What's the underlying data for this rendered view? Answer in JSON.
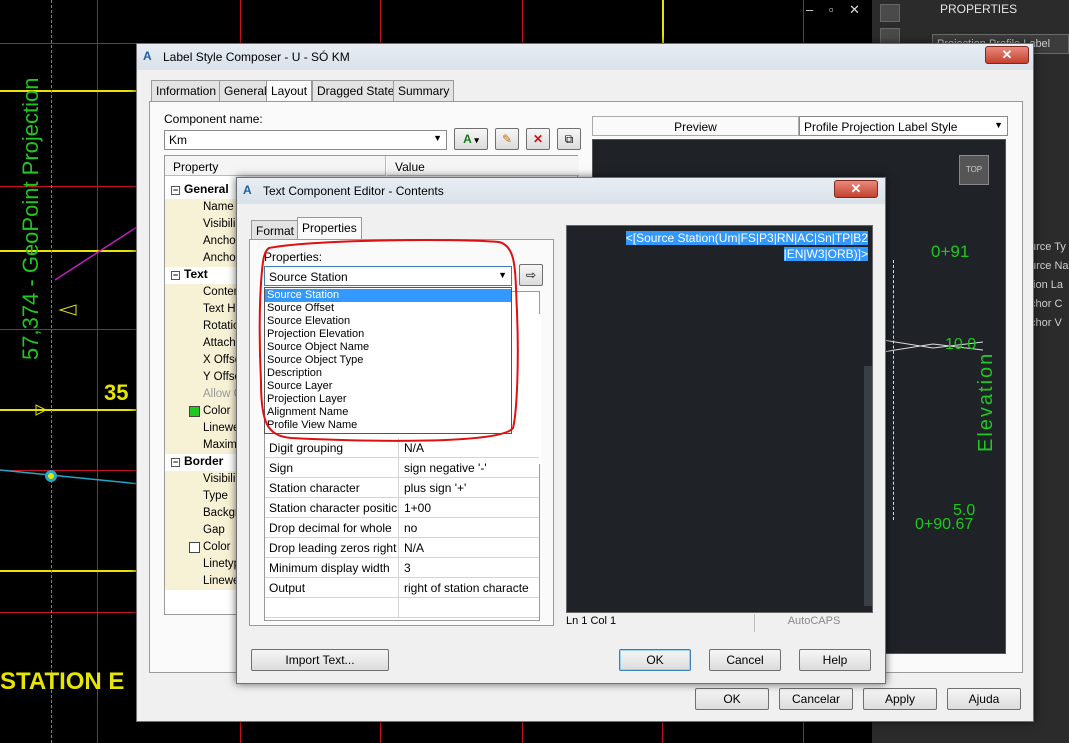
{
  "cad": {
    "vertical_text": "57,374 - GeoPoint Projection",
    "number_35": "35",
    "station_text": "STATION E",
    "preview_labels": {
      "top_station": "0+91",
      "elev_upper": "10.0",
      "elev_lower": "5.0",
      "bottom_station": "0+90.67",
      "elevation_axis": "Elevation"
    },
    "top_button": "TOP"
  },
  "window_controls": "– ▫ ✕",
  "properties_palette": {
    "title": "PROPERTIES",
    "combo_value": "Projection Profile Label",
    "rows": [
      "urce Ty",
      "urce Na",
      "tion La",
      "chor C",
      "chor V"
    ]
  },
  "label_style_composer": {
    "title": "Label Style Composer - U - SÓ KM",
    "close": "✕",
    "tabs": [
      "Information",
      "General",
      "Layout",
      "Dragged State",
      "Summary"
    ],
    "active_tab": "Layout",
    "component_name_label": "Component name:",
    "component_name_value": "Km",
    "grid_headers": {
      "property": "Property",
      "value": "Value"
    },
    "categories": {
      "general": {
        "label": "General",
        "items": [
          "Name",
          "Visibili",
          "Ancho",
          "Ancho"
        ]
      },
      "text": {
        "label": "Text",
        "items": [
          "Conten",
          "Text H",
          "Rotatio",
          "Attach",
          "X Offse",
          "Y Offse",
          "Allow C",
          "Color",
          "Linewe",
          "Maximu"
        ]
      },
      "border": {
        "label": "Border",
        "items": [
          "Visibili",
          "Type",
          "Backgr",
          "Gap",
          "Color",
          "Linetyp",
          "Linewe"
        ]
      }
    },
    "preview_label": "Preview",
    "preview_style": "Profile Projection Label Style",
    "buttons": {
      "ok": "OK",
      "cancel": "Cancelar",
      "apply": "Apply",
      "help": "Ajuda"
    }
  },
  "text_component_editor": {
    "title": "Text Component Editor - Contents",
    "close": "✕",
    "tabs": [
      "Format",
      "Properties"
    ],
    "active_tab": "Properties",
    "properties_label": "Properties:",
    "properties_value": "Source Station",
    "dropdown_options": [
      "Source Station",
      "Source Offset",
      "Source Elevation",
      "Projection Elevation",
      "Source Object Name",
      "Source Object Type",
      "Description",
      "Source Layer",
      "Projection Layer",
      "Alignment Name",
      "Profile View Name"
    ],
    "selected_option": "Source Station",
    "grid_rows": [
      {
        "k": "Digit grouping",
        "v": "N/A"
      },
      {
        "k": "Sign",
        "v": "sign negative '-'"
      },
      {
        "k": "Station character",
        "v": "plus sign '+'"
      },
      {
        "k": "Station character positic",
        "v": "1+00"
      },
      {
        "k": "Drop decimal for whole",
        "v": "no"
      },
      {
        "k": "Drop leading zeros right",
        "v": "N/A"
      },
      {
        "k": "Minimum display width",
        "v": "3"
      },
      {
        "k": "Output",
        "v": "right of station characte"
      }
    ],
    "editor_text_line1": "<[Source Station(Um|FS|P3|RN|AC|Sn|TP|B2",
    "editor_text_line2": "|EN|W3|ORB)]>",
    "status_pos": "Ln 1 Col 1",
    "status_caps": "AutoCAPS",
    "buttons": {
      "import": "Import Text...",
      "ok": "OK",
      "cancel": "Cancel",
      "help": "Help"
    }
  },
  "colors": {
    "cad_bg": "#000000",
    "grid_red": "#c8141e",
    "cad_green": "#1ec81e",
    "cad_yellow": "#e6e600",
    "annotation_red": "#e01010",
    "selection_blue": "#3399ff"
  }
}
